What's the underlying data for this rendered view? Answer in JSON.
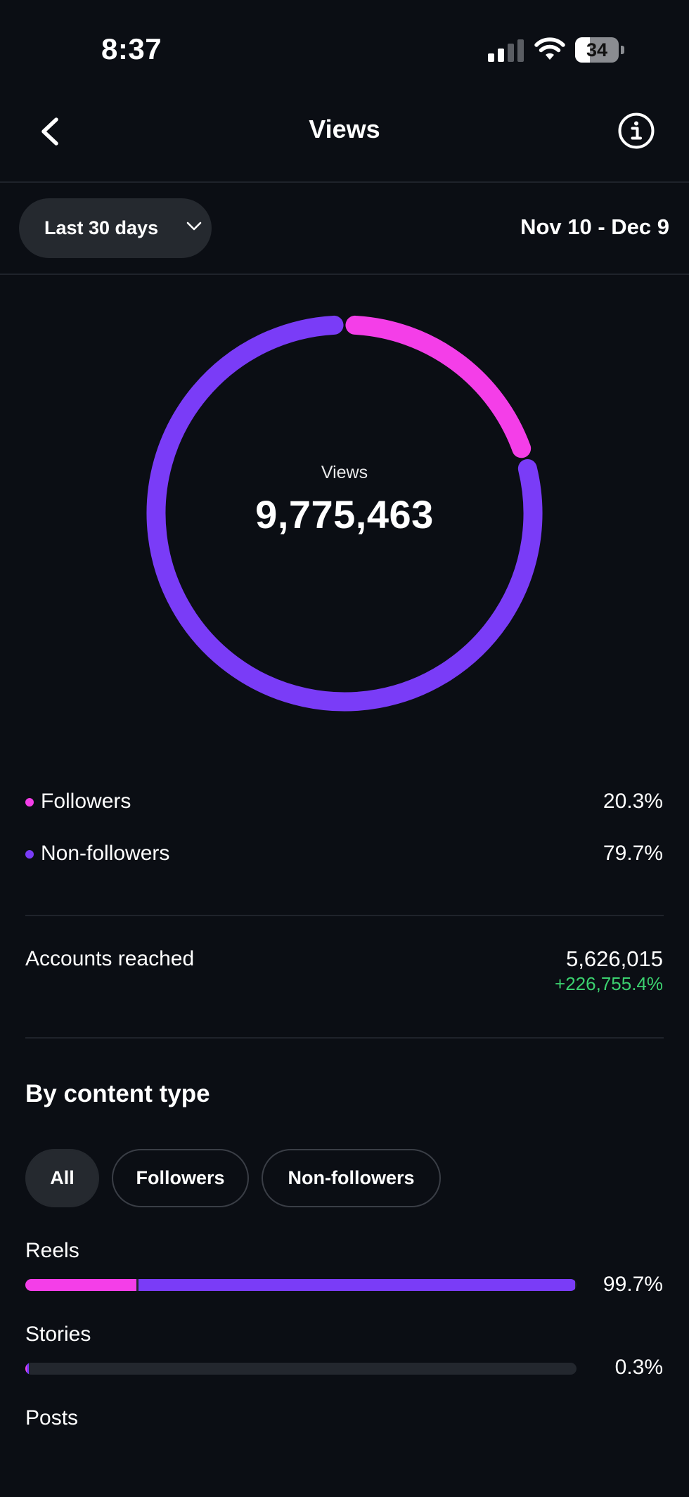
{
  "status_bar": {
    "time": "8:37",
    "battery_level": "34",
    "battery_fraction": 0.34,
    "icons": [
      "cellular-signal-icon",
      "wifi-icon",
      "battery-icon"
    ]
  },
  "header": {
    "title": "Views",
    "back_icon": "chevron-left-icon",
    "info_icon": "info-circle-icon"
  },
  "filter": {
    "range_label": "Last 30 days",
    "range_icon": "chevron-down-icon",
    "date_range": "Nov 10 - Dec 9"
  },
  "colors": {
    "followers": "#f43ee8",
    "non_followers": "#7a3cf7",
    "positive_change": "#3bd16f",
    "background": "#0b0e14"
  },
  "chart_data": {
    "type": "pie",
    "center_label": "Views",
    "center_value": "9,775,463",
    "series": [
      {
        "name": "Followers",
        "value": 20.3,
        "label": "20.3%",
        "color": "#f43ee8"
      },
      {
        "name": "Non-followers",
        "value": 79.7,
        "label": "79.7%",
        "color": "#7a3cf7"
      }
    ]
  },
  "accounts_reached": {
    "label": "Accounts reached",
    "value": "5,626,015",
    "change": "+226,755.4%"
  },
  "content_type": {
    "title": "By content type",
    "tabs": [
      {
        "label": "All",
        "active": true
      },
      {
        "label": "Followers",
        "active": false
      },
      {
        "label": "Non-followers",
        "active": false
      }
    ],
    "rows": [
      {
        "label": "Reels",
        "total_pct": "99.7%",
        "total": 99.7,
        "followers": 20.2,
        "non_followers": 79.5
      },
      {
        "label": "Stories",
        "total_pct": "0.3%",
        "total": 0.3,
        "followers": 0.1,
        "non_followers": 0.2
      },
      {
        "label": "Posts"
      }
    ]
  }
}
